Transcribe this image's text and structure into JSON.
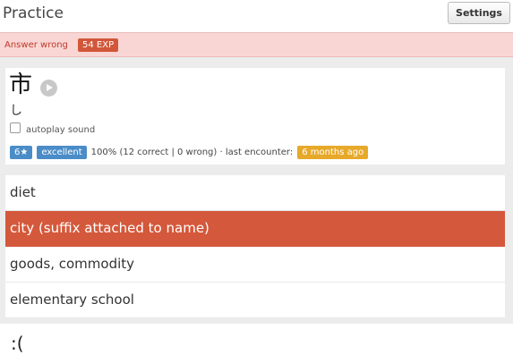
{
  "header": {
    "title": "Practice",
    "settings_label": "Settings"
  },
  "feedback": {
    "text": "Answer wrong",
    "exp_badge": "54 EXP",
    "color": "#f9d6d4"
  },
  "card": {
    "kanji": "市",
    "reading": "し",
    "play_icon": "play-icon",
    "autoplay_label": "autoplay sound",
    "level_badge": "6★",
    "grade_badge": "excellent",
    "stats_text": "100% (12 correct | 0 wrong)  · last encounter:",
    "last_encounter": "6 months ago"
  },
  "answers": [
    {
      "label": "diet",
      "selected": false
    },
    {
      "label": "city (suffix attached to name)",
      "selected": true
    },
    {
      "label": "goods, commodity",
      "selected": false
    },
    {
      "label": "elementary school",
      "selected": false
    }
  ],
  "result_face": ":(",
  "colors": {
    "wrong": "#d4583b",
    "badge_blue": "#4a8cc7",
    "badge_orange": "#e7a92a"
  }
}
